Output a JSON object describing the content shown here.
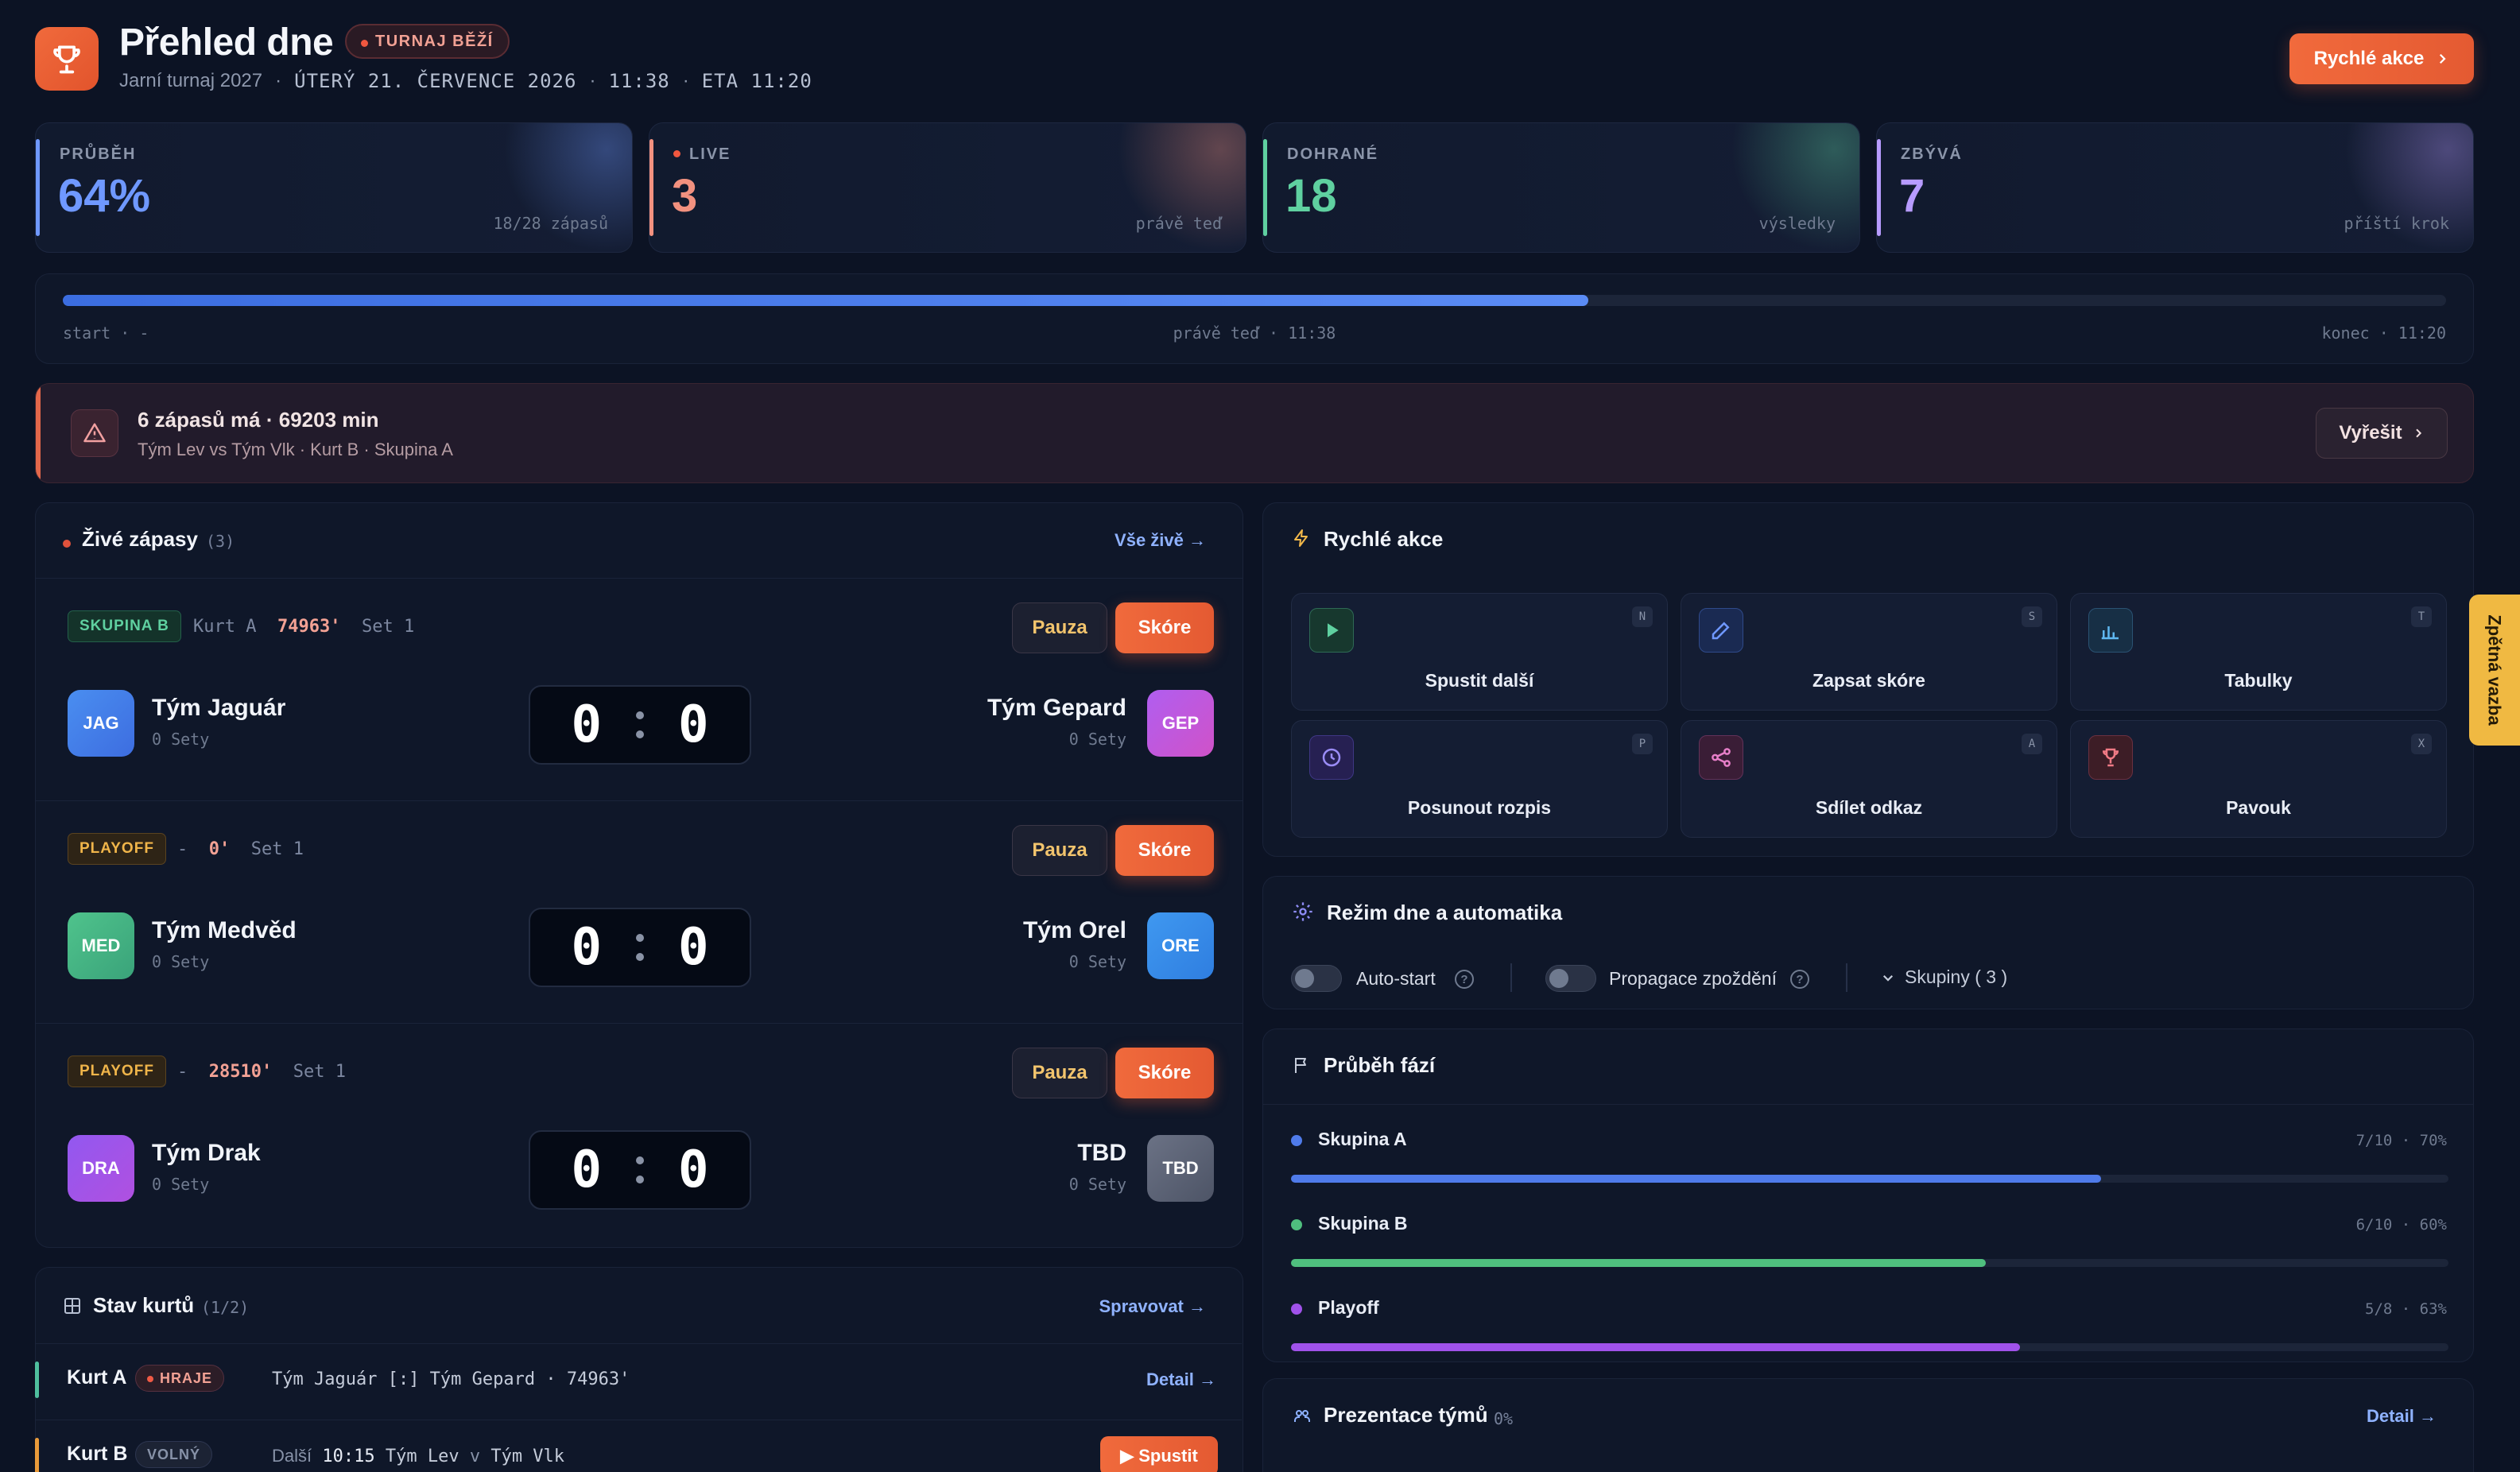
{
  "header": {
    "title": "Přehled dne",
    "live_badge": "TURNAJ BĚŽÍ",
    "tournament": "Jarní turnaj 2027",
    "date": "ÚTERÝ 21. ČERVENCE 2026",
    "time": "11:38",
    "eta": "ETA 11:20",
    "separator": "·",
    "quick_actions_button": "Rychlé akce"
  },
  "stats": [
    {
      "label": "PRŮBĚH",
      "value": "64%",
      "note": "18/28 zápasů",
      "color": "#6f98ff"
    },
    {
      "label": "LIVE",
      "value": "3",
      "note": "právě teď",
      "color": "#f2917f"
    },
    {
      "label": "DOHRANÉ",
      "value": "18",
      "note": "výsledky",
      "color": "#5fd0a0"
    },
    {
      "label": "ZBÝVÁ",
      "value": "7",
      "note": "příští krok",
      "color": "#b79bff"
    }
  ],
  "progress": {
    "fraction": 0.64,
    "start_label": "start · -",
    "now_label": "právě teď · 11:38",
    "end_label": "konec · 11:20"
  },
  "alert": {
    "title": "6 zápasů má · 69203 min",
    "detail": "Tým Lev vs Tým Vlk · Kurt B · Skupina A",
    "button": "Vyřešit"
  },
  "live_matches": {
    "title": "Živé zápasy",
    "count": "(3)",
    "link": "Vše živě →",
    "pause_label": "Pauza",
    "score_label": "Skóre",
    "items": [
      {
        "tag": "SKUPINA B",
        "court": "Kurt A",
        "minute": "74963'",
        "set": "Set 1",
        "home": {
          "abbr": "JAG",
          "name": "Tým Jaguár",
          "sets": "0 Sety"
        },
        "away": {
          "abbr": "GEP",
          "name": "Tým Gepard",
          "sets": "0 Sety"
        },
        "score_home": "0",
        "score_away": "0"
      },
      {
        "tag": "PLAYOFF",
        "court": "-",
        "minute": "0'",
        "set": "Set 1",
        "home": {
          "abbr": "MED",
          "name": "Tým Medvěd",
          "sets": "0 Sety"
        },
        "away": {
          "abbr": "ORE",
          "name": "Tým Orel",
          "sets": "0 Sety"
        },
        "score_home": "0",
        "score_away": "0"
      },
      {
        "tag": "PLAYOFF",
        "court": "-",
        "minute": "28510'",
        "set": "Set 1",
        "home": {
          "abbr": "DRA",
          "name": "Tým Drak",
          "sets": "0 Sety"
        },
        "away": {
          "abbr": "TBD",
          "name": "TBD",
          "sets": "0 Sety"
        },
        "score_home": "0",
        "score_away": "0"
      }
    ]
  },
  "courts": {
    "title": "Stav kurtů",
    "count": "(1/2)",
    "link": "Spravovat →",
    "items": [
      {
        "name": "Kurt A",
        "badge": "HRAJE",
        "desc": "Tým Jaguár [:] Tým Gepard · 74963'",
        "action": "Detail →"
      },
      {
        "name": "Kurt B",
        "badge": "VOLNÝ",
        "next_label": "Další",
        "next_time": "10:15",
        "next_home": "Tým Lev",
        "next_vs": "v",
        "next_away": "Tým Vlk",
        "action": "▶ Spustit"
      }
    ]
  },
  "quick_actions": {
    "title": "Rychlé akce",
    "items": [
      {
        "label": "Spustit další",
        "key": "N",
        "icon": "play-icon"
      },
      {
        "label": "Zapsat skóre",
        "key": "S",
        "icon": "pen-icon"
      },
      {
        "label": "Tabulky",
        "key": "T",
        "icon": "bar-chart-icon"
      },
      {
        "label": "Posunout rozpis",
        "key": "P",
        "icon": "clock-icon"
      },
      {
        "label": "Sdílet odkaz",
        "key": "A",
        "icon": "share-icon"
      },
      {
        "label": "Pavouk",
        "key": "X",
        "icon": "trophy-icon"
      }
    ]
  },
  "automation": {
    "title": "Režim dne a automatika",
    "autostart": "Auto-start",
    "delay_propagation": "Propagace zpoždění",
    "groups_label": "Skupiny ( 3 )"
  },
  "phases": {
    "title": "Průběh fází",
    "items": [
      {
        "name": "Skupina A",
        "stat": "7/10 · 70%",
        "fraction": 0.7,
        "color": "#4f7bea"
      },
      {
        "name": "Skupina B",
        "stat": "6/10 · 60%",
        "fraction": 0.6,
        "color": "#4fbf7e"
      },
      {
        "name": "Playoff",
        "stat": "5/8 · 63%",
        "fraction": 0.63,
        "color": "#a052ea"
      }
    ]
  },
  "presentation": {
    "title": "Prezentace týmů",
    "count": "0%",
    "link": "Detail →"
  },
  "feedback": "Zpětná vazba"
}
